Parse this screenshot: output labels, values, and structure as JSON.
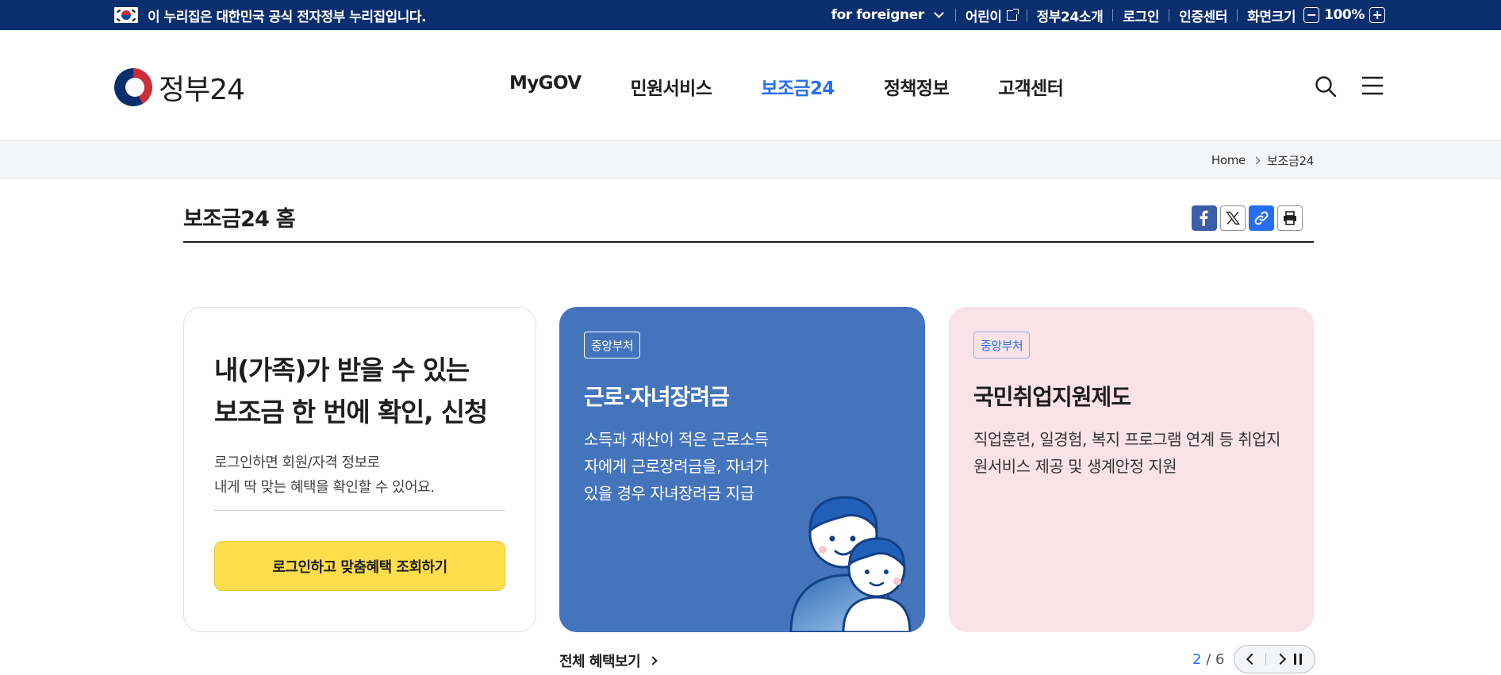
{
  "govbar": {
    "notice": "이 누리집은 대한민국 공식 전자정부 누리집입니다.",
    "foreigner": "for foreigner",
    "kids": "어린이",
    "about": "정부24소개",
    "login": "로그인",
    "cert": "인증센터",
    "screen_size": "화면크기",
    "zoom_minus": "−",
    "zoom_level": "100%",
    "zoom_plus": "+"
  },
  "header": {
    "logo_text": "정부24",
    "nav": [
      {
        "label": "MyGOV"
      },
      {
        "label": "민원서비스"
      },
      {
        "label": "보조금24",
        "active": true
      },
      {
        "label": "정책정보"
      },
      {
        "label": "고객센터"
      }
    ]
  },
  "breadcrumb": {
    "home": "Home",
    "current": "보조금24"
  },
  "page": {
    "title": "보조금24 홈"
  },
  "login_card": {
    "heading_line1": "내(가족)가 받을 수 있는",
    "heading_line2": "보조금 한 번에 확인, 신청",
    "desc_line1": "로그인하면 회원/자격 정보로",
    "desc_line2": "내게 딱 맞는 혜택을 확인할 수 있어요.",
    "button": "로그인하고 맞춤혜택 조회하기"
  },
  "cards": [
    {
      "badge": "중앙부처",
      "title": "근로·자녀장려금",
      "desc": "소득과 재산이 적은 근로소득자에게 근로장려금을, 자녀가 있을 경우 자녀장려금 지급",
      "bg": "#4474bb"
    },
    {
      "badge": "중앙부처",
      "title": "국민취업지원제도",
      "desc": "직업훈련, 일경험, 복지 프로그램 연계 등 취업지원서비스 제공 및 생계안정 지원",
      "bg": "#f9e3e8"
    }
  ],
  "footer_controls": {
    "more": "전체 혜택보기",
    "page_current": "2",
    "page_sep": "/",
    "page_total": "6"
  },
  "colors": {
    "govbar": "#0b2e6e",
    "accent": "#256ef4",
    "button_yellow": "#ffde4d"
  }
}
